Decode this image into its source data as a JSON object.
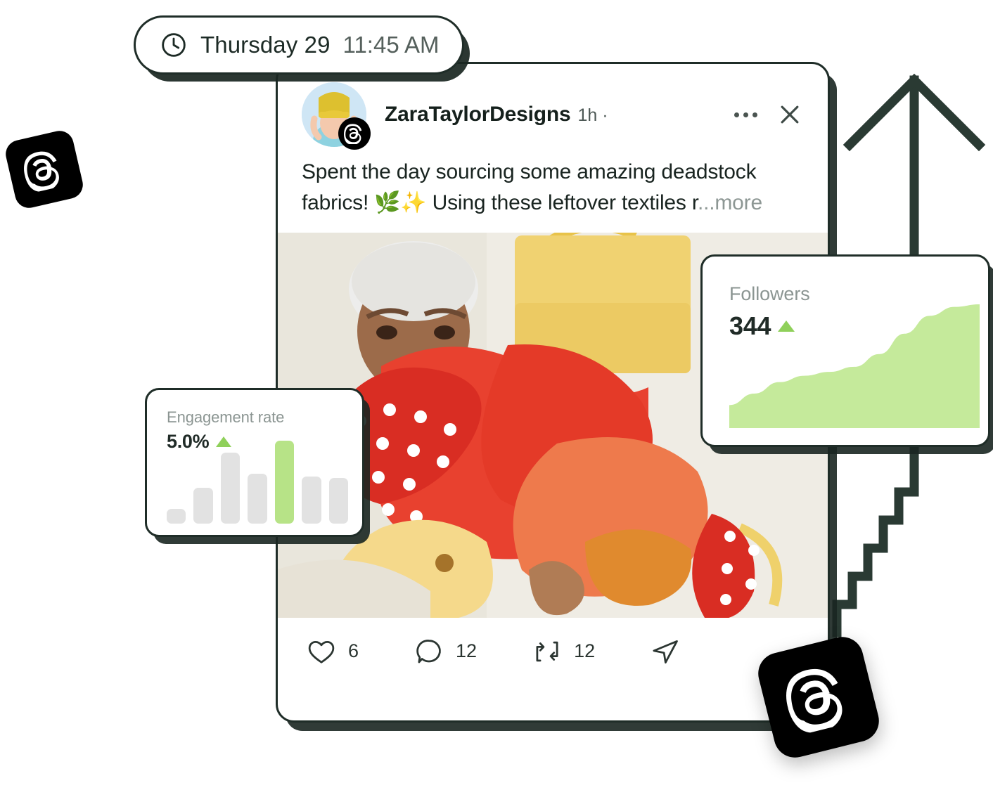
{
  "colors": {
    "accent_green": "#b7e387",
    "area_green": "#c5ea9b",
    "outline_dark": "#1f2d28",
    "arrow_dark": "#2a3a33",
    "bar_gray": "#e2e2e2",
    "muted_text": "#8b9592"
  },
  "time_pill": {
    "icon": "clock-icon",
    "day": "Thursday 29",
    "clock": "11:45 AM"
  },
  "post": {
    "author": "ZaraTaylorDesigns",
    "timestamp": "1h ·",
    "avatar_alt": "person-in-yellow-beanie",
    "platform_badge": "threads-logo-icon",
    "more_icon": "more-options-icon",
    "close_icon": "close-icon",
    "text_line_1": "Spent the day sourcing some amazing deadstock",
    "text_line_2": "fabrics! 🌿✨ Using these leftover textiles r",
    "more_label": "...more",
    "media_alt": "person-holding-pile-of-colorful-deadstock-clothing",
    "actions": [
      {
        "name": "like",
        "icon": "heart-icon",
        "count": "6"
      },
      {
        "name": "comment",
        "icon": "comment-icon",
        "count": "12"
      },
      {
        "name": "repost",
        "icon": "repost-icon",
        "count": "12"
      },
      {
        "name": "share",
        "icon": "share-icon",
        "count": ""
      }
    ]
  },
  "engagement_card": {
    "label": "Engagement rate",
    "value": "5.0%",
    "trend": "up"
  },
  "followers_card": {
    "label": "Followers",
    "value": "344",
    "trend": "up"
  },
  "chart_data": [
    {
      "type": "bar",
      "title": "Engagement rate",
      "categories": [
        "1",
        "2",
        "3",
        "4",
        "5",
        "6",
        "7"
      ],
      "values": [
        18,
        43,
        86,
        60,
        100,
        57,
        55
      ],
      "highlight_index": 4,
      "highlight_color": "#b7e387",
      "base_color": "#e2e2e2",
      "xlabel": "",
      "ylabel": "",
      "ylim": [
        0,
        100
      ],
      "grid": false,
      "legend": "none"
    },
    {
      "type": "area",
      "title": "Followers",
      "x": [
        0,
        1,
        2,
        3,
        4,
        5,
        6,
        7,
        8,
        9,
        10
      ],
      "values": [
        18,
        27,
        36,
        41,
        44,
        48,
        58,
        74,
        88,
        95,
        97
      ],
      "fill_color": "#c5ea9b",
      "xlabel": "",
      "ylabel": "",
      "ylim": [
        0,
        100
      ],
      "grid": false,
      "legend": "none"
    }
  ],
  "decor": {
    "arrow_icon": "growth-arrow-icon",
    "tile_small_icon": "threads-logo-icon",
    "tile_large_icon": "threads-logo-icon"
  }
}
